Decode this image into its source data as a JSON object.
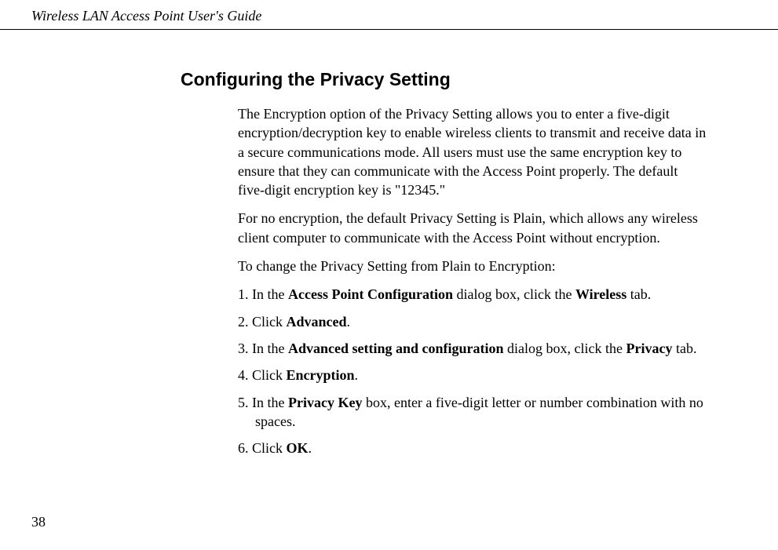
{
  "header": {
    "title": "Wireless LAN Access Point User's Guide"
  },
  "section": {
    "heading": "Configuring the Privacy Setting",
    "para1": "The Encryption option of the Privacy Setting allows you to enter a five-digit encryption/decryption key to enable wireless clients to transmit and receive data in a secure communications mode. All users must use the same encryption key to ensure that they can communicate with the Access Point properly. The default five-digit encryption key is \"12345.\"",
    "para2": "For no encryption, the default Privacy Setting is Plain, which allows any wireless client computer to communicate with the Access Point without encryption.",
    "para3": "To change the Privacy Setting from Plain to Encryption:",
    "step1": {
      "prefix": "1. In the ",
      "bold1": "Access Point Configuration",
      "mid": " dialog box, click the ",
      "bold2": "Wireless",
      "suffix": " tab."
    },
    "step2": {
      "prefix": "2. Click ",
      "bold1": "Advanced",
      "suffix": "."
    },
    "step3": {
      "prefix": "3. In the ",
      "bold1": "Advanced setting and configuration",
      "mid": " dialog box, click the ",
      "bold2": "Privacy",
      "suffix": " tab."
    },
    "step4": {
      "prefix": "4. Click ",
      "bold1": "Encryption",
      "suffix": "."
    },
    "step5": {
      "prefix": "5. In the ",
      "bold1": "Privacy Key",
      "suffix": " box, enter a five-digit letter or number combination with no spaces."
    },
    "step6": {
      "prefix": "6. Click ",
      "bold1": "OK",
      "suffix": "."
    }
  },
  "pageNumber": "38"
}
